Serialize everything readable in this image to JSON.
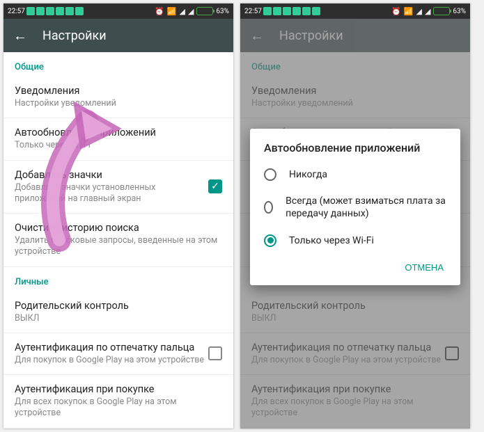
{
  "status": {
    "time": "22:57",
    "battery_pct": "63%"
  },
  "appbar": {
    "title": "Настройки"
  },
  "sections": {
    "general": "Общие",
    "personal": "Личные"
  },
  "items": {
    "notifications": {
      "title": "Уведомления",
      "sub": "Настройки уведомлений"
    },
    "autoupdate": {
      "title": "Автообновление приложений",
      "sub": "Только через Wi-Fi"
    },
    "add_icons": {
      "title": "Добавлять значки",
      "sub": "Добавлять значки установленных приложений на главный экран"
    },
    "clear_history": {
      "title": "Очистить историю поиска",
      "sub": "Удалить поисковые запросы, введенные на этом устройстве"
    },
    "parental": {
      "title": "Родительский контроль",
      "sub": "ВЫКЛ"
    },
    "fingerprint": {
      "title": "Аутентификация по отпечатку пальца",
      "sub": "Для покупок в Google Play на этом устройстве"
    },
    "purchase_auth": {
      "title": "Аутентификация при покупке",
      "sub": "Для всех покупок в Google Play на этом устройстве"
    }
  },
  "dialog": {
    "title": "Автообновление приложений",
    "options": {
      "never": "Никогда",
      "always": "Всегда (может взиматься плата за передачу данных)",
      "wifi": "Только через Wi-Fi"
    },
    "cancel": "ОТМЕНА"
  }
}
